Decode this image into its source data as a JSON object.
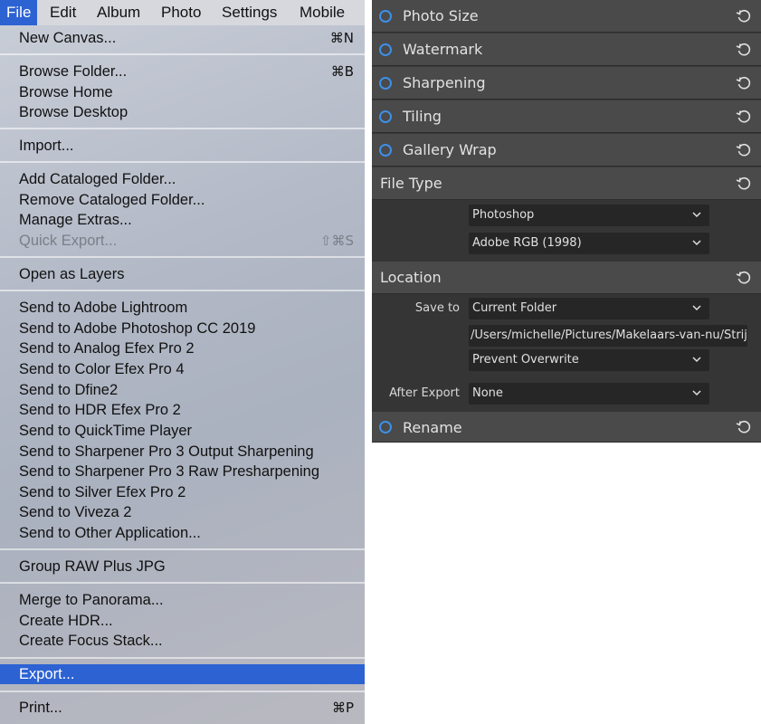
{
  "menubar": {
    "items": [
      "File",
      "Edit",
      "Album",
      "Photo",
      "Settings",
      "Mobile"
    ]
  },
  "file_menu": {
    "items": [
      {
        "label": "New Canvas...",
        "shortcut": "⌘N"
      },
      {
        "label": "Browse Folder...",
        "shortcut": "⌘B"
      },
      {
        "label": "Browse Home",
        "shortcut": ""
      },
      {
        "label": "Browse Desktop",
        "shortcut": ""
      },
      {
        "label": "Import...",
        "shortcut": ""
      },
      {
        "label": "Add Cataloged Folder...",
        "shortcut": ""
      },
      {
        "label": "Remove Cataloged Folder...",
        "shortcut": ""
      },
      {
        "label": "Manage Extras...",
        "shortcut": ""
      },
      {
        "label": "Quick Export...",
        "shortcut": "⇧⌘S",
        "disabled": true
      },
      {
        "label": "Open as Layers",
        "shortcut": ""
      },
      {
        "label": "Send to Adobe Lightroom",
        "shortcut": ""
      },
      {
        "label": "Send to Adobe Photoshop CC 2019",
        "shortcut": ""
      },
      {
        "label": "Send to Analog Efex Pro 2",
        "shortcut": ""
      },
      {
        "label": "Send to Color Efex Pro 4",
        "shortcut": ""
      },
      {
        "label": "Send to Dfine2",
        "shortcut": ""
      },
      {
        "label": "Send to HDR Efex Pro 2",
        "shortcut": ""
      },
      {
        "label": "Send to QuickTime Player",
        "shortcut": ""
      },
      {
        "label": "Send to Sharpener Pro 3 Output Sharpening",
        "shortcut": ""
      },
      {
        "label": "Send to Sharpener Pro 3 Raw Presharpening",
        "shortcut": ""
      },
      {
        "label": "Send to Silver Efex Pro 2",
        "shortcut": ""
      },
      {
        "label": "Send to Viveza 2",
        "shortcut": ""
      },
      {
        "label": "Send to Other Application...",
        "shortcut": ""
      },
      {
        "label": "Group RAW Plus JPG",
        "shortcut": ""
      },
      {
        "label": "Merge to Panorama...",
        "shortcut": ""
      },
      {
        "label": "Create HDR...",
        "shortcut": ""
      },
      {
        "label": "Create Focus Stack...",
        "shortcut": ""
      },
      {
        "label": "Export...",
        "shortcut": "",
        "highlighted": true
      },
      {
        "label": "Print...",
        "shortcut": "⌘P"
      }
    ]
  },
  "export_panel": {
    "sections": [
      {
        "title": "Photo Size"
      },
      {
        "title": "Watermark"
      },
      {
        "title": "Sharpening"
      },
      {
        "title": "Tiling"
      },
      {
        "title": "Gallery Wrap"
      }
    ],
    "file_type": {
      "title": "File Type",
      "format": "Photoshop",
      "color_profile": "Adobe RGB (1998)"
    },
    "location": {
      "title": "Location",
      "save_to_label": "Save to",
      "save_to_value": "Current Folder",
      "path": "/Users/michelle/Pictures/Makelaars-van-nu/Strijp-S",
      "overwrite": "Prevent Overwrite",
      "after_export_label": "After Export",
      "after_export_value": "None"
    },
    "rename": {
      "title": "Rename"
    }
  },
  "colors": {
    "menu_highlight": "#2d62d3",
    "panel_background": "#3a3a3a",
    "toggle_accent": "#3d8fe8"
  }
}
